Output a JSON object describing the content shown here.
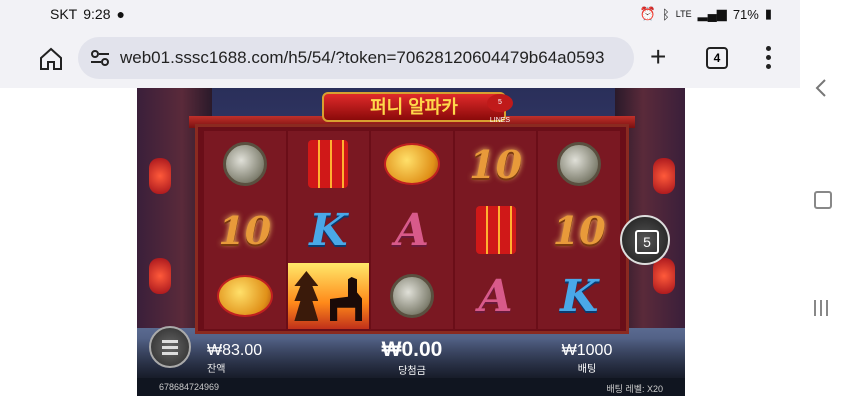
{
  "status_bar": {
    "carrier": "SKT",
    "time": "9:28",
    "battery": "71%",
    "network": "LTE"
  },
  "browser": {
    "url": "web01.sssc1688.com/h5/54/?token=70628120604479b64a0593",
    "tab_count": "4"
  },
  "game": {
    "logo": "퍼니 알파카",
    "logo_badge": "5 LINES",
    "lines_button": "5",
    "reels": [
      [
        "gong",
        "ten",
        "lantern"
      ],
      [
        "firecracker",
        "K",
        "alpaca"
      ],
      [
        "lantern",
        "A",
        "gong"
      ],
      [
        "ten",
        "firecracker",
        "A"
      ],
      [
        "gong",
        "ten",
        "K"
      ]
    ],
    "symbol_labels": {
      "ten": "10",
      "K": "K",
      "A": "A"
    },
    "balance_value": "₩83.00",
    "balance_label": "잔액",
    "win_value": "₩0.00",
    "win_label": "당첨금",
    "bet_value": "₩1000",
    "bet_label": "배팅",
    "session_id": "678684724969",
    "bet_level": "배팅 레벨: X20"
  },
  "colors": {
    "accent_red": "#c01a1a",
    "reel_bg": "#7a1822",
    "gold": "#e89a3a"
  }
}
